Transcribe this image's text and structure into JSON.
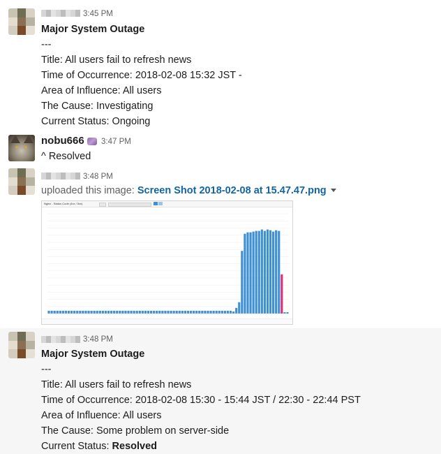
{
  "messages": [
    {
      "time": "3:45 PM",
      "title": "Major System Outage",
      "separator": "---",
      "lines": [
        "Title: All users fail to refresh news",
        "Time of Occurrence: 2018-02-08 15:32 JST -",
        "Area of Influence: All users",
        "The Cause: Investigating",
        "Current Status: Ongoing"
      ]
    },
    {
      "username": "nobu666",
      "time": "3:47 PM",
      "text": "^ Resolved"
    },
    {
      "time": "3:48 PM",
      "upload_prefix": "uploaded this image:",
      "file_name": "Screen Shot 2018-02-08 at 15.47.47.png",
      "screenshot_title": "Nginx - Status Code (4xx / 5xx)"
    },
    {
      "time": "3:48 PM",
      "title": "Major System Outage",
      "separator": "---",
      "line1": "Title: All users fail to refresh news",
      "line2": "Time of Occurrence: 2018-02-08 15:30 - 15:44 JST / 22:30 - 22:44 PST",
      "line3": "Area of Influence: All users",
      "line4": "The Cause: Some problem on server-side",
      "status_label": "Current Status:",
      "status_value": "Resolved"
    }
  ],
  "chart_data": {
    "type": "bar",
    "series": [
      {
        "values": [
          4,
          4,
          4,
          4,
          4,
          4,
          4,
          4,
          4,
          4,
          4,
          4,
          4,
          4,
          4,
          4,
          4,
          4,
          4,
          4,
          4,
          4,
          4,
          4,
          4,
          4,
          4,
          4,
          4,
          4,
          4,
          4,
          4,
          4,
          4,
          4,
          4,
          4,
          4,
          4,
          4,
          4,
          4,
          4,
          4,
          4,
          4,
          4,
          4,
          4,
          4,
          4,
          4,
          4,
          4,
          4,
          4,
          4,
          4,
          4,
          4,
          4,
          4,
          4,
          4,
          3,
          8,
          16,
          88,
          112,
          114,
          114,
          115,
          116,
          116,
          118,
          116,
          118,
          117,
          115,
          117,
          116,
          2,
          2,
          2
        ]
      },
      {
        "values": [
          0,
          0,
          0,
          0,
          0,
          0,
          0,
          0,
          0,
          0,
          0,
          0,
          0,
          0,
          0,
          0,
          0,
          0,
          0,
          0,
          0,
          0,
          0,
          0,
          0,
          0,
          0,
          0,
          0,
          0,
          0,
          0,
          0,
          0,
          0,
          0,
          0,
          0,
          0,
          0,
          0,
          0,
          0,
          0,
          0,
          0,
          0,
          0,
          0,
          0,
          0,
          0,
          0,
          0,
          0,
          0,
          0,
          0,
          0,
          0,
          0,
          0,
          0,
          0,
          0,
          0,
          0,
          0,
          0,
          0,
          0,
          0,
          0,
          0,
          0,
          0,
          0,
          0,
          0,
          0,
          0,
          0,
          55,
          0,
          0
        ]
      }
    ],
    "ylim": [
      0,
      145
    ],
    "grid": true,
    "colors": [
      "#3f8fd3",
      "#d6317a"
    ]
  },
  "colors": {
    "link": "#1264a3",
    "highlight_bg": "#f6f6f6",
    "bar_blue": "#3f8fd3",
    "bar_pink": "#d6317a"
  },
  "icons": {
    "file_caret": "chevron-down-icon",
    "badge": "status-emoji-icon"
  }
}
